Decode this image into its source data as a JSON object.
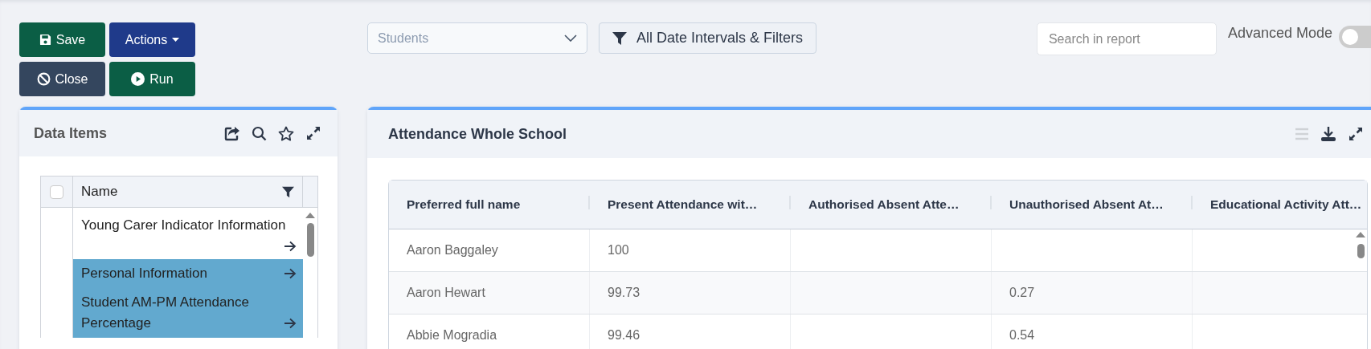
{
  "toolbar": {
    "buttons": [
      {
        "kind": "save",
        "label": "Save"
      },
      {
        "kind": "actions",
        "label": "Actions"
      },
      {
        "kind": "close",
        "label": "Close"
      },
      {
        "kind": "run",
        "label": "Run"
      }
    ],
    "entity_select": {
      "placeholder": "Students"
    },
    "filters_button": {
      "label": "All Date Intervals & Filters"
    },
    "search": {
      "placeholder": "Search in report"
    },
    "advanced_mode": {
      "label": "Advanced Mode",
      "on": false
    }
  },
  "data_items": {
    "title": "Data Items",
    "header": {
      "label": "Name",
      "checked": false
    },
    "items": [
      {
        "label": "Young Carer Indicator Information",
        "selected": false
      },
      {
        "label": "Personal Information",
        "selected": true
      },
      {
        "label": "Student AM-PM Attendance Percentage",
        "selected": true
      }
    ]
  },
  "report": {
    "title": "Attendance Whole School",
    "actions": [
      {
        "kind": "list",
        "disabled": true
      },
      {
        "kind": "download",
        "disabled": false
      },
      {
        "kind": "expand",
        "disabled": false
      }
    ],
    "table": {
      "columns": [
        "Preferred full name",
        "Present Attendance wit…",
        "Authorised Absent Atte…",
        "Unauthorised Absent At…",
        "Educational Activity Att…"
      ],
      "rows": [
        [
          "Aaron Baggaley",
          "100",
          null,
          null,
          null
        ],
        [
          "Aaron Hewart",
          "99.73",
          null,
          "0.27",
          null
        ],
        [
          "Abbie Mogradia",
          "99.46",
          null,
          "0.54",
          null
        ]
      ]
    }
  }
}
